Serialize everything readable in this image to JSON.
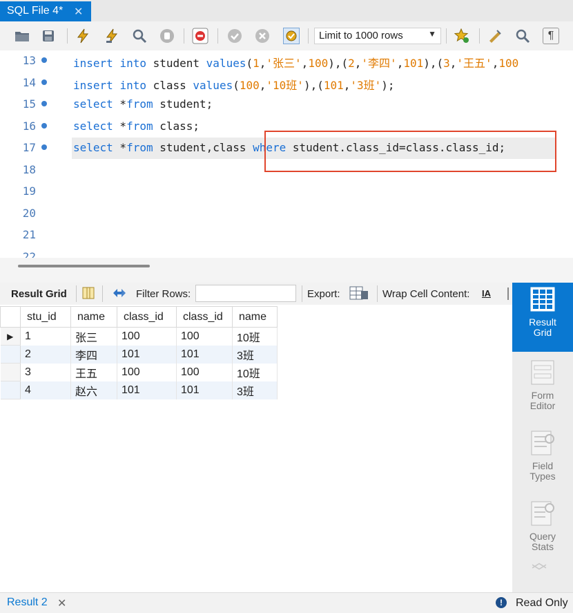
{
  "tab": {
    "label": "SQL File 4*",
    "close": "✕"
  },
  "toolbar": {
    "limit_label": "Limit to 1000 rows",
    "icons": [
      "open-folder-icon",
      "save-icon",
      "execute-icon",
      "execute-current-icon",
      "explain-icon",
      "stop-icon",
      "toggle-error-icon",
      "commit-icon",
      "rollback-icon",
      "autocommit-icon",
      "add-snippet-icon",
      "beautify-icon",
      "find-icon",
      "invisible-chars-icon"
    ]
  },
  "editor": {
    "lines": [
      {
        "num": "13",
        "dot": true,
        "tokens": [
          [
            "kw",
            "insert"
          ],
          [
            "t",
            " "
          ],
          [
            "kw",
            "into"
          ],
          [
            "t",
            " student "
          ],
          [
            "kw",
            "values"
          ],
          [
            "t",
            "("
          ],
          [
            "str",
            "1"
          ],
          [
            "t",
            ","
          ],
          [
            "str",
            "'张三'"
          ],
          [
            "t",
            ","
          ],
          [
            "str",
            "100"
          ],
          [
            "t",
            "),("
          ],
          [
            "str",
            "2"
          ],
          [
            "t",
            ","
          ],
          [
            "str",
            "'李四'"
          ],
          [
            "t",
            ","
          ],
          [
            "str",
            "101"
          ],
          [
            "t",
            "),("
          ],
          [
            "str",
            "3"
          ],
          [
            "t",
            ","
          ],
          [
            "str",
            "'王五'"
          ],
          [
            "t",
            ","
          ],
          [
            "str",
            "100"
          ]
        ]
      },
      {
        "num": "14",
        "dot": true,
        "tokens": [
          [
            "kw",
            "insert"
          ],
          [
            "t",
            " "
          ],
          [
            "kw",
            "into"
          ],
          [
            "t",
            " class "
          ],
          [
            "kw",
            "values"
          ],
          [
            "t",
            "("
          ],
          [
            "str",
            "100"
          ],
          [
            "t",
            ","
          ],
          [
            "str",
            "'10班'"
          ],
          [
            "t",
            "),("
          ],
          [
            "str",
            "101"
          ],
          [
            "t",
            ","
          ],
          [
            "str",
            "'3班'"
          ],
          [
            "t",
            ");"
          ]
        ]
      },
      {
        "num": "15",
        "dot": true,
        "tokens": [
          [
            "kw",
            "select"
          ],
          [
            "t",
            " *"
          ],
          [
            "kw",
            "from"
          ],
          [
            "t",
            " student;"
          ]
        ]
      },
      {
        "num": "16",
        "dot": true,
        "tokens": [
          [
            "kw",
            "select"
          ],
          [
            "t",
            " *"
          ],
          [
            "kw",
            "from"
          ],
          [
            "t",
            " class;"
          ]
        ]
      },
      {
        "num": "17",
        "dot": true,
        "tokens": [
          [
            "kw",
            "select"
          ],
          [
            "t",
            " *"
          ],
          [
            "kw",
            "from"
          ],
          [
            "t",
            " student,class "
          ],
          [
            "kw",
            "where"
          ],
          [
            "t",
            " student.class_id=class.class_id;"
          ]
        ]
      },
      {
        "num": "18",
        "dot": false,
        "tokens": []
      },
      {
        "num": "19",
        "dot": false,
        "tokens": []
      },
      {
        "num": "20",
        "dot": false,
        "tokens": []
      },
      {
        "num": "21",
        "dot": false,
        "tokens": []
      },
      {
        "num": "22",
        "dot": false,
        "tokens": []
      }
    ]
  },
  "result_toolbar": {
    "result_grid": "Result Grid",
    "filter_rows": "Filter Rows:",
    "export": "Export:",
    "wrap": "Wrap Cell Content:"
  },
  "grid": {
    "columns": [
      "stu_id",
      "name",
      "class_id",
      "class_id",
      "name"
    ],
    "rows": [
      [
        "1",
        "张三",
        "100",
        "100",
        "10班"
      ],
      [
        "2",
        "李四",
        "101",
        "101",
        "3班"
      ],
      [
        "3",
        "王五",
        "100",
        "100",
        "10班"
      ],
      [
        "4",
        "赵六",
        "101",
        "101",
        "3班"
      ]
    ],
    "current_row_marker": "▶"
  },
  "side_panel": {
    "result_grid": [
      "Result",
      "Grid"
    ],
    "form_editor": [
      "Form",
      "Editor"
    ],
    "field_types": [
      "Field",
      "Types"
    ],
    "query_stats": [
      "Query",
      "Stats"
    ]
  },
  "bottom": {
    "tab_label": "Result 2",
    "close": "✕",
    "status": "Read Only",
    "status_icon": "!"
  },
  "colors": {
    "accent": "#0a78d1",
    "keyword": "#1a6fd4",
    "string": "#e07a00",
    "highlight_box": "#e0452c"
  }
}
